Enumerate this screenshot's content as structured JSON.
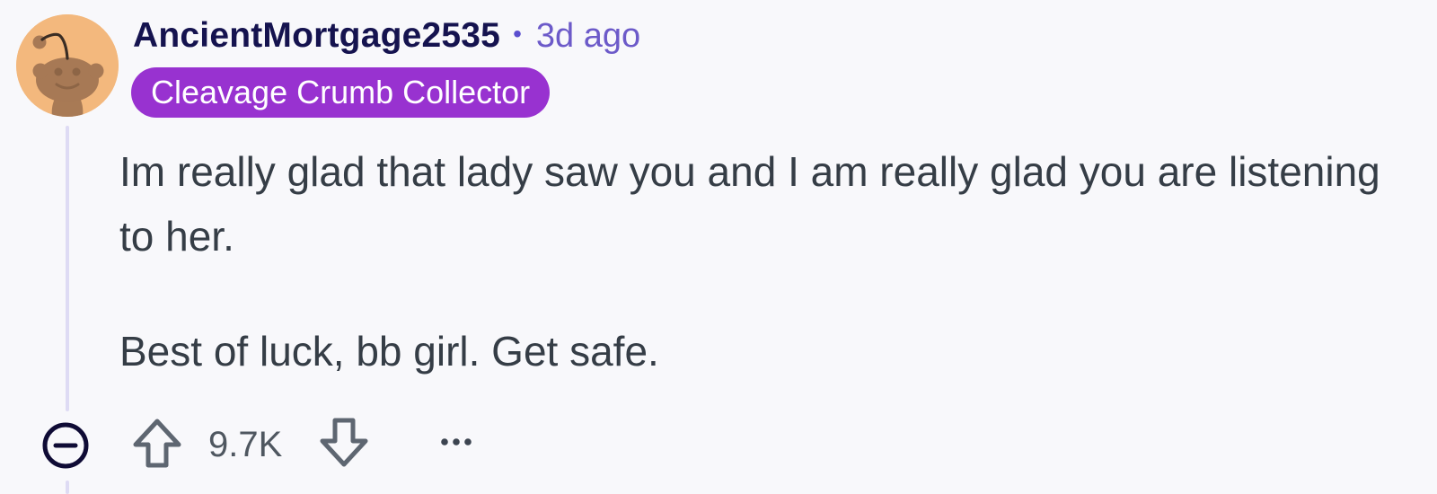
{
  "comment": {
    "author": "AncientMortgage2535",
    "separator": "•",
    "timestamp": "3d ago",
    "flair": "Cleavage Crumb Collector",
    "body": [
      "Im really glad that lady saw you and I am really glad you are listening to her.",
      "Best of luck, bb girl. Get safe."
    ]
  },
  "actions": {
    "vote_count": "9.7K",
    "icons": {
      "collapse": "collapse-minus-icon",
      "upvote": "upvote-arrow-icon",
      "downvote": "downvote-arrow-icon",
      "more": "more-options-icon"
    }
  },
  "colors": {
    "background": "#f8f8fb",
    "username": "#15134f",
    "timestamp": "#6c5ac9",
    "flair_bg": "#9832d0",
    "avatar_bg": "#f3b87d",
    "thread_line": "#dedbf4"
  }
}
